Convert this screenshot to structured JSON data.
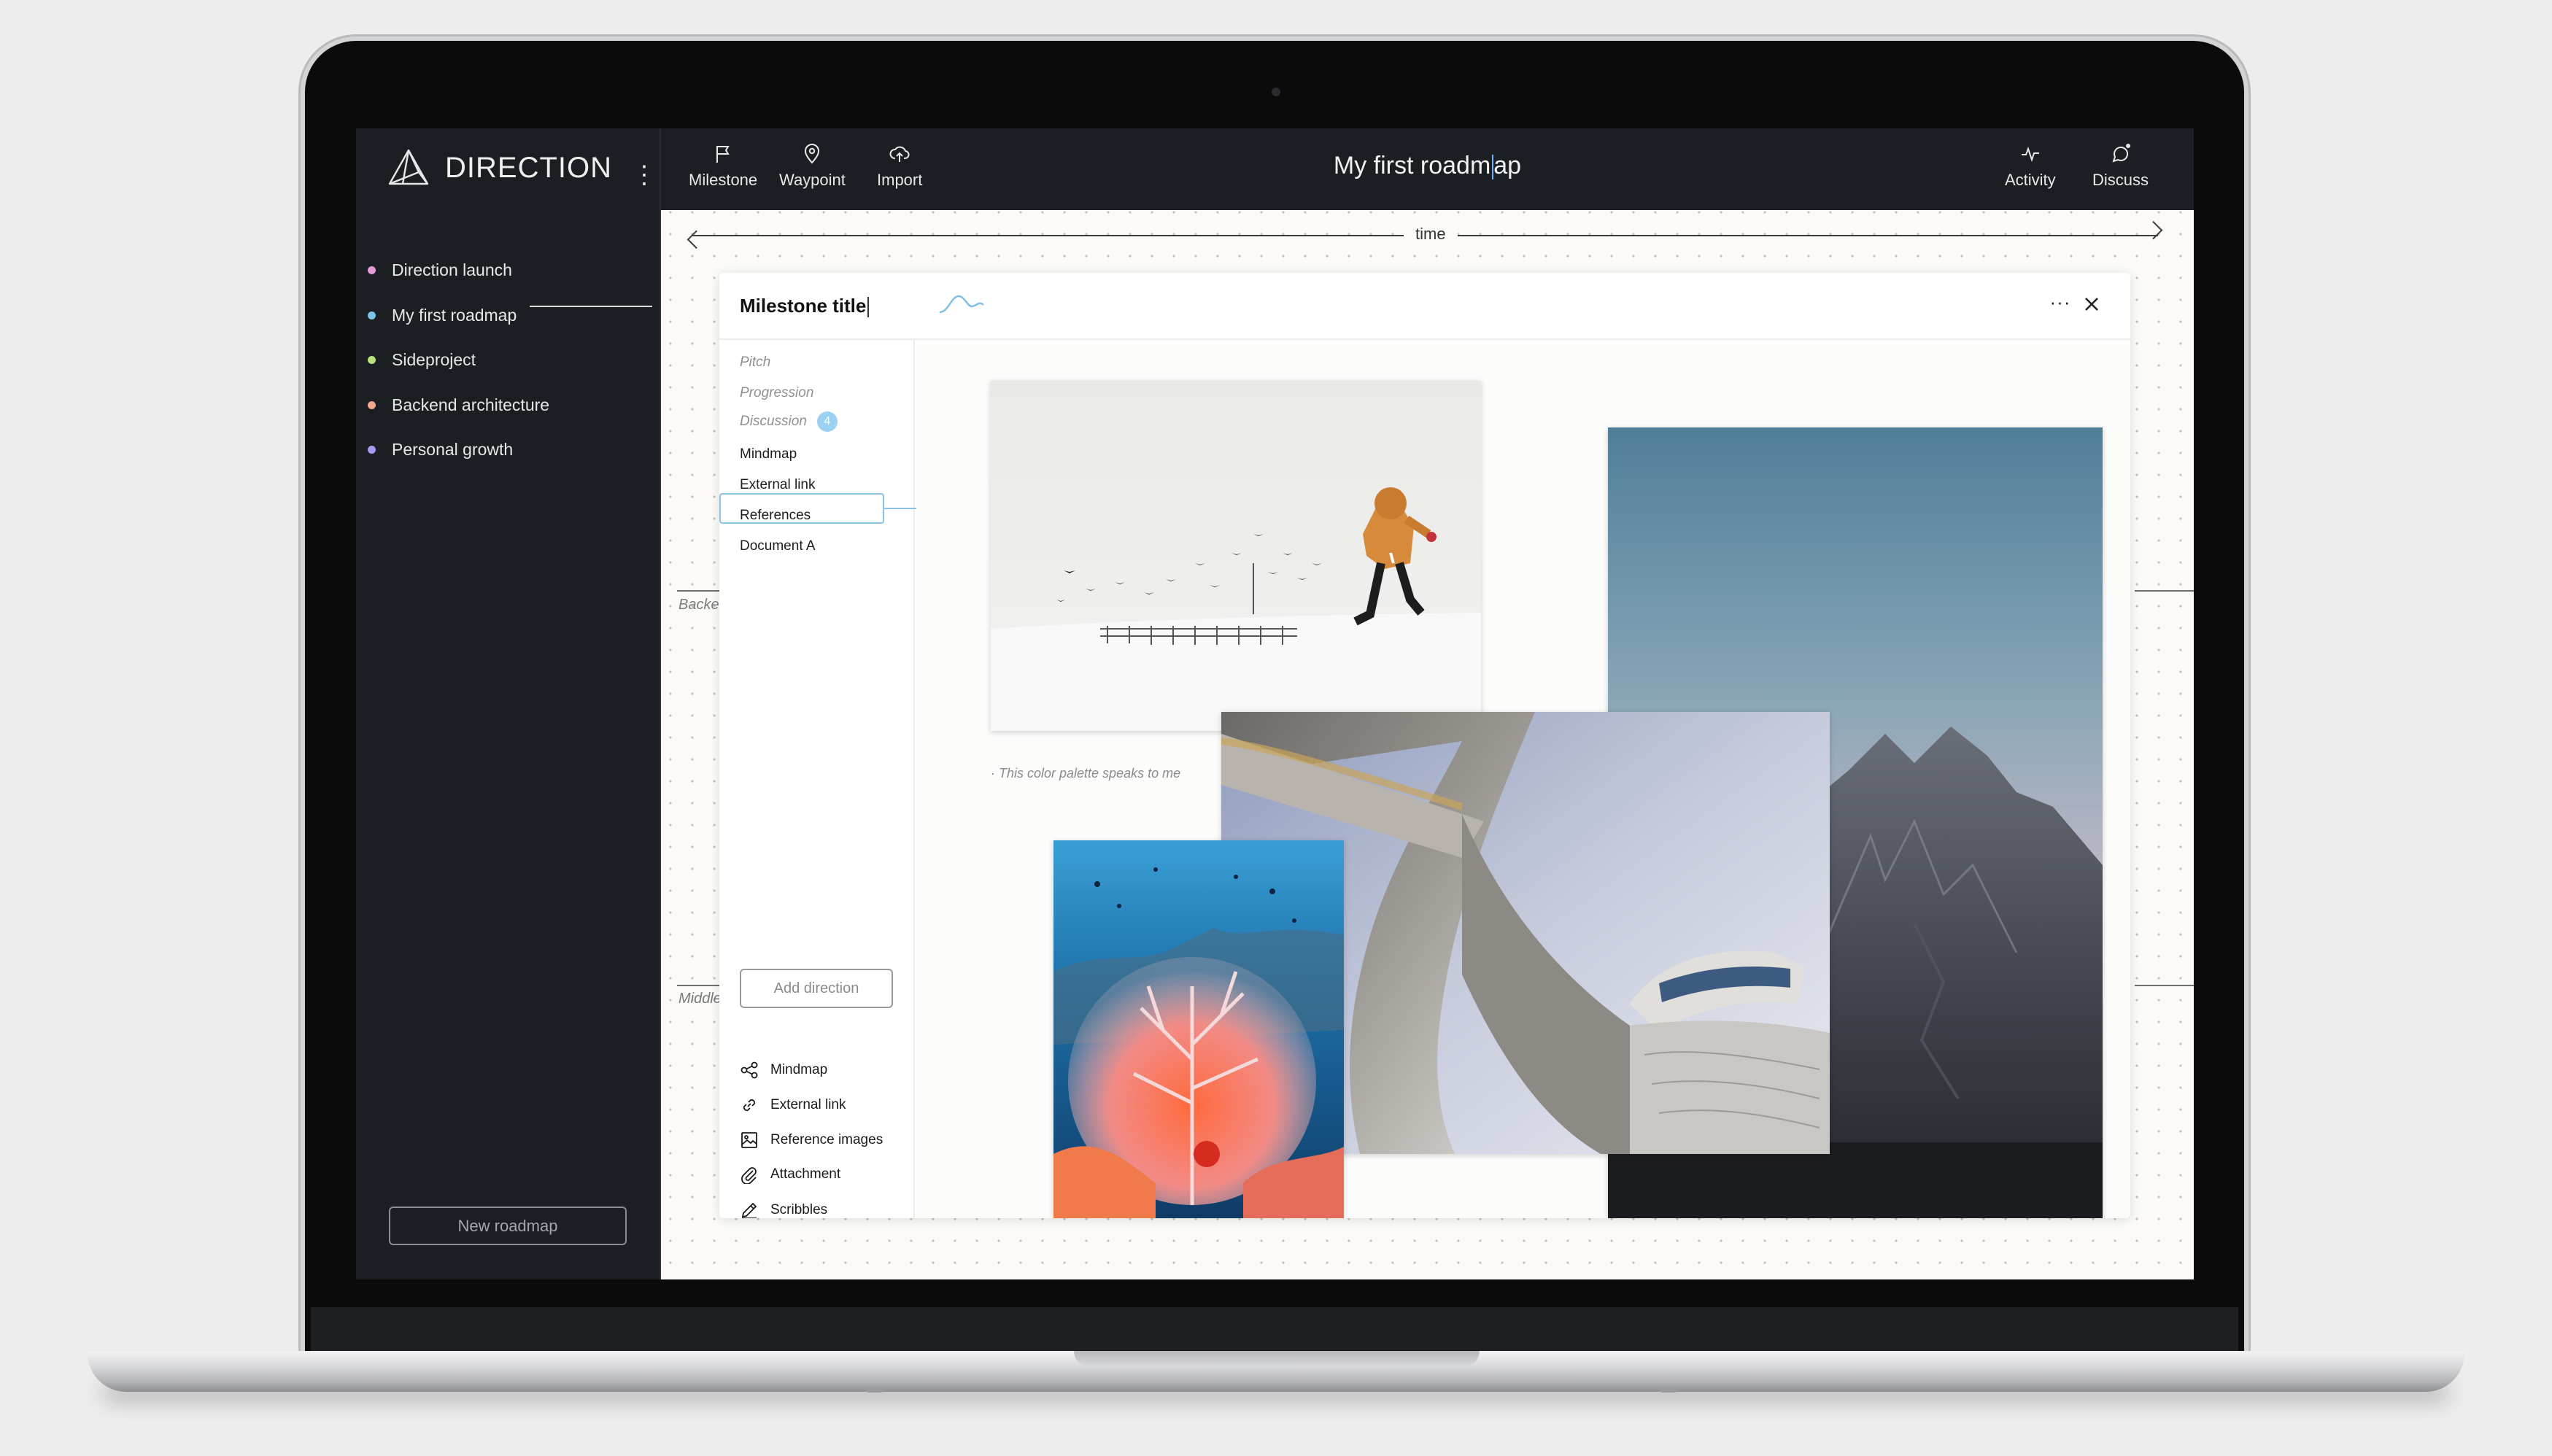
{
  "app": {
    "name": "DIRECTION"
  },
  "sidebar": {
    "roadmaps": [
      {
        "label": "Direction launch",
        "color": "#e39ad6"
      },
      {
        "label": "My first roadmap",
        "color": "#7cc2ea",
        "active": true
      },
      {
        "label": "Sideproject",
        "color": "#b9e07a"
      },
      {
        "label": "Backend architecture",
        "color": "#f0a78a"
      },
      {
        "label": "Personal growth",
        "color": "#a59af0"
      }
    ],
    "new_roadmap_label": "New roadmap"
  },
  "toolbar": {
    "left": [
      {
        "label": "Milestone",
        "icon": "flag-icon"
      },
      {
        "label": "Waypoint",
        "icon": "location-pin-icon"
      },
      {
        "label": "Import",
        "icon": "cloud-upload-icon"
      }
    ],
    "right": [
      {
        "label": "Activity",
        "icon": "activity-icon"
      },
      {
        "label": "Discuss",
        "icon": "chat-bubble-icon"
      }
    ],
    "roadmap_title": "My first roadmap"
  },
  "canvas": {
    "time_label": "time",
    "lanes": [
      "Backen",
      "Middle"
    ]
  },
  "milestone": {
    "title": "Milestone title",
    "nav": [
      {
        "label": "Pitch",
        "muted": true
      },
      {
        "label": "Progression",
        "muted": true
      },
      {
        "label": "Discussion",
        "muted": true,
        "badge": "4"
      },
      {
        "label": "Mindmap"
      },
      {
        "label": "External link"
      },
      {
        "label": "References",
        "selected": true
      },
      {
        "label": "Document A"
      }
    ],
    "add_direction_label": "Add direction",
    "addons": [
      {
        "label": "Mindmap",
        "icon": "share-nodes-icon"
      },
      {
        "label": "External link",
        "icon": "link-icon"
      },
      {
        "label": "Reference images",
        "icon": "image-icon"
      },
      {
        "label": "Attachment",
        "icon": "paperclip-icon"
      },
      {
        "label": "Scribbles",
        "icon": "pencil-icon"
      }
    ],
    "references": {
      "caption": "· This color palette speaks to me",
      "images": [
        "snow-walker-photo",
        "mountain-photo",
        "architecture-photo",
        "coral-reef-photo"
      ]
    }
  }
}
